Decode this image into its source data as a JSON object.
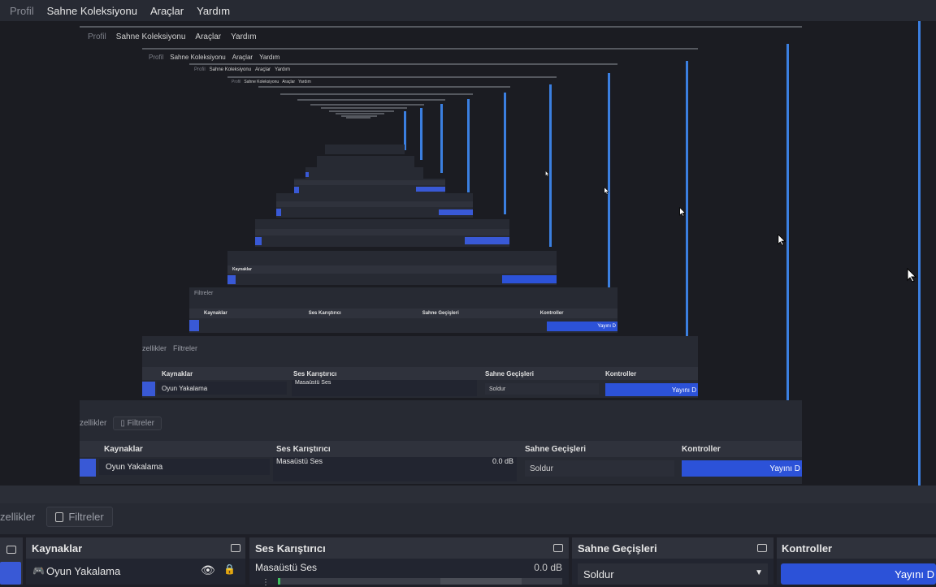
{
  "menu": {
    "profile": "Profil",
    "scene_collection": "Sahne Koleksiyonu",
    "tools": "Araçlar",
    "help": "Yardım"
  },
  "dock_tabs": {
    "properties": "zellikler",
    "filters": "Filtreler"
  },
  "panels": {
    "sources": {
      "title": "Kaynaklar",
      "item": "Oyun Yakalama"
    },
    "audio_mixer": {
      "title": "Ses Karıştırıcı",
      "channel": "Masaüstü Ses",
      "level": "0.0 dB"
    },
    "scene_transitions": {
      "title": "Sahne Geçişleri",
      "selected": "Soldur"
    },
    "controls": {
      "title": "Kontroller",
      "stream_button": "Yayını D"
    }
  },
  "colors": {
    "accent_blue": "#2c52d8",
    "line_blue": "#3b7fe0",
    "panel_bg": "#272a33"
  }
}
